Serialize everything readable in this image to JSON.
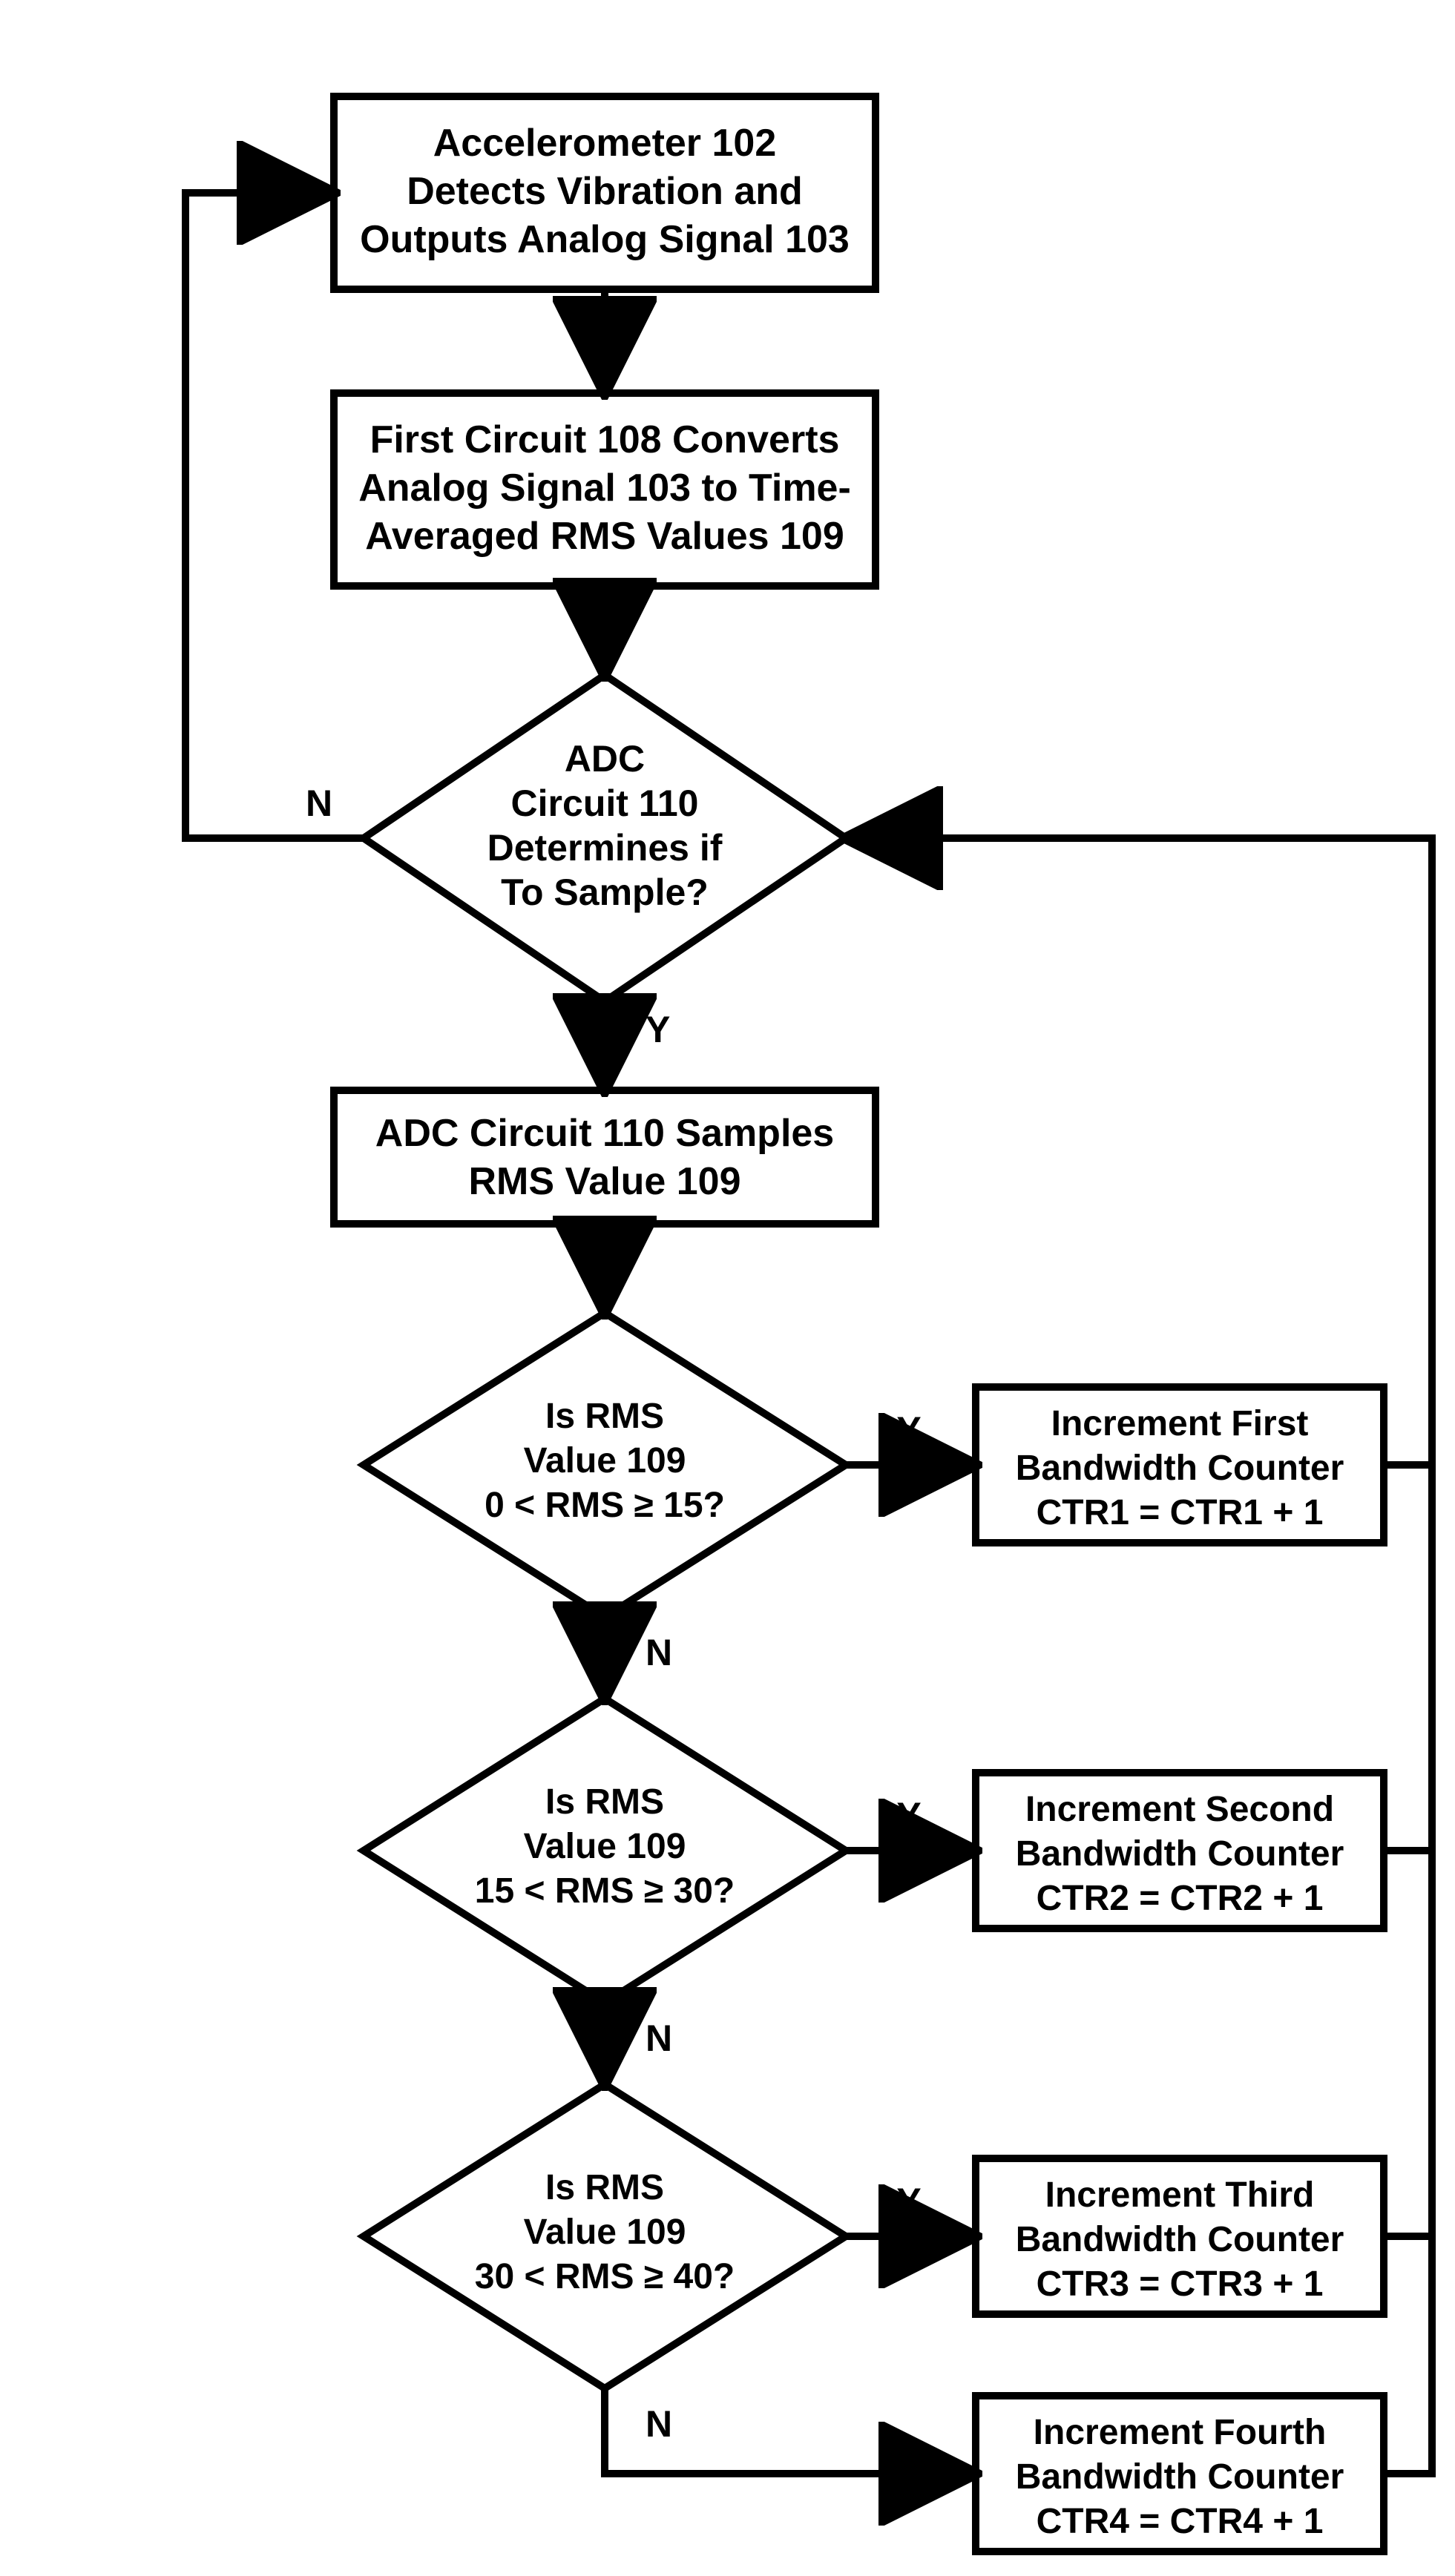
{
  "flow": {
    "n1": {
      "l1": "Accelerometer 102",
      "l2": "Detects Vibration and",
      "l3": "Outputs Analog Signal 103"
    },
    "n2": {
      "l1": "First Circuit 108 Converts",
      "l2": "Analog Signal 103 to Time-",
      "l3": "Averaged RMS Values 109"
    },
    "n3": {
      "l1": "ADC",
      "l2": "Circuit 110",
      "l3": "Determines if",
      "l4": "To Sample?"
    },
    "n4": {
      "l1": "ADC Circuit 110 Samples",
      "l2": "RMS Value 109"
    },
    "d1": {
      "l1": "Is RMS",
      "l2": "Value 109",
      "l3": "0 < RMS ≥ 15?"
    },
    "d2": {
      "l1": "Is RMS",
      "l2": "Value 109",
      "l3": "15 < RMS ≥ 30?"
    },
    "d3": {
      "l1": "Is RMS",
      "l2": "Value 109",
      "l3": "30 < RMS ≥ 40?"
    },
    "a1": {
      "l1": "Increment First",
      "l2": "Bandwidth Counter",
      "l3": "CTR1 = CTR1 + 1"
    },
    "a2": {
      "l1": "Increment Second",
      "l2": "Bandwidth Counter",
      "l3": "CTR2 = CTR2 + 1"
    },
    "a3": {
      "l1": "Increment Third",
      "l2": "Bandwidth Counter",
      "l3": "CTR3 = CTR3 + 1"
    },
    "a4": {
      "l1": "Increment Fourth",
      "l2": "Bandwidth Counter",
      "l3": "CTR4 = CTR4 + 1"
    }
  },
  "labels": {
    "yes": "Y",
    "no": "N"
  }
}
